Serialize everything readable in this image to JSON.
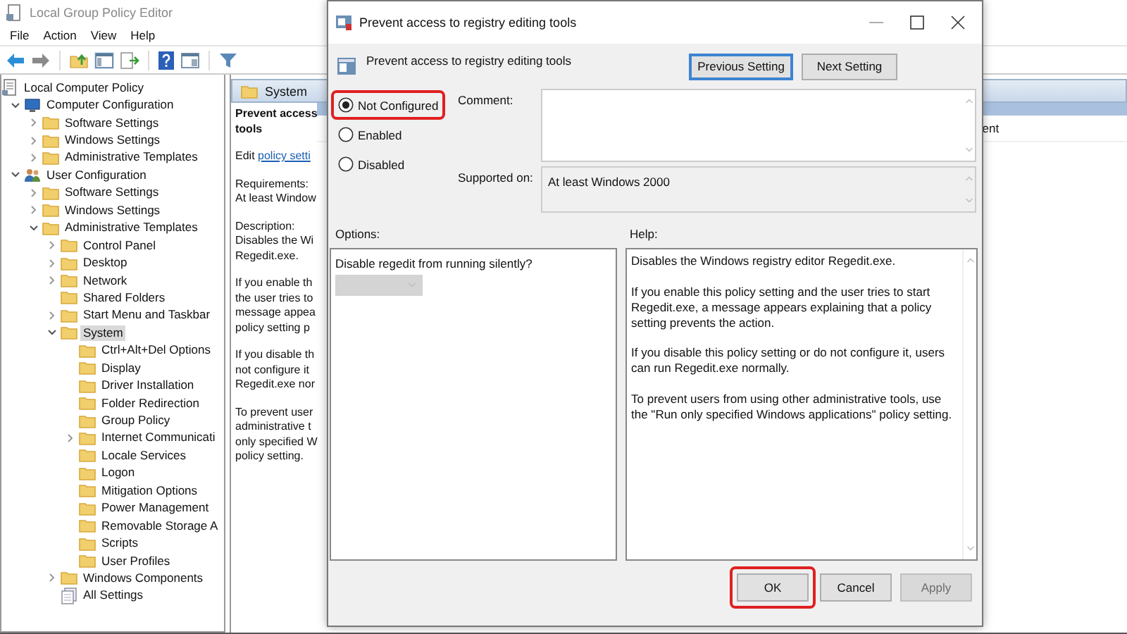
{
  "main_window": {
    "title": "Local Group Policy Editor",
    "menu": [
      "File",
      "Action",
      "View",
      "Help"
    ]
  },
  "tree": [
    {
      "label": "Local Computer Policy",
      "kind": "policy",
      "selected": false,
      "children": [
        {
          "label": "Computer Configuration",
          "kind": "computer",
          "expanded": true,
          "selected": false,
          "children": [
            {
              "label": "Software Settings",
              "kind": "folder",
              "expanded": false,
              "selected": false
            },
            {
              "label": "Windows Settings",
              "kind": "folder",
              "expanded": false,
              "selected": false
            },
            {
              "label": "Administrative Templates",
              "kind": "folder",
              "expanded": false,
              "selected": false
            }
          ]
        },
        {
          "label": "User Configuration",
          "kind": "user",
          "expanded": true,
          "selected": false,
          "children": [
            {
              "label": "Software Settings",
              "kind": "folder",
              "expanded": false,
              "selected": false
            },
            {
              "label": "Windows Settings",
              "kind": "folder",
              "expanded": false,
              "selected": false
            },
            {
              "label": "Administrative Templates",
              "kind": "folder",
              "expanded": true,
              "selected": false,
              "children": [
                {
                  "label": "Control Panel",
                  "kind": "folder",
                  "expanded": false,
                  "selected": false
                },
                {
                  "label": "Desktop",
                  "kind": "folder",
                  "expanded": false,
                  "selected": false
                },
                {
                  "label": "Network",
                  "kind": "folder",
                  "expanded": false,
                  "selected": false
                },
                {
                  "label": "Shared Folders",
                  "kind": "folder",
                  "selected": false
                },
                {
                  "label": "Start Menu and Taskbar",
                  "kind": "folder",
                  "expanded": false,
                  "selected": false
                },
                {
                  "label": "System",
                  "kind": "folder",
                  "expanded": true,
                  "selected": true,
                  "children": [
                    {
                      "label": "Ctrl+Alt+Del Options",
                      "kind": "folder",
                      "selected": false
                    },
                    {
                      "label": "Display",
                      "kind": "folder",
                      "selected": false
                    },
                    {
                      "label": "Driver Installation",
                      "kind": "folder",
                      "selected": false
                    },
                    {
                      "label": "Folder Redirection",
                      "kind": "folder",
                      "selected": false
                    },
                    {
                      "label": "Group Policy",
                      "kind": "folder",
                      "selected": false
                    },
                    {
                      "label": "Internet Communicati",
                      "kind": "folder",
                      "expanded": false,
                      "selected": false
                    },
                    {
                      "label": "Locale Services",
                      "kind": "folder",
                      "selected": false
                    },
                    {
                      "label": "Logon",
                      "kind": "folder",
                      "selected": false
                    },
                    {
                      "label": "Mitigation Options",
                      "kind": "folder",
                      "selected": false
                    },
                    {
                      "label": "Power Management",
                      "kind": "folder",
                      "selected": false
                    },
                    {
                      "label": "Removable Storage A",
                      "kind": "folder",
                      "selected": false
                    },
                    {
                      "label": "Scripts",
                      "kind": "folder",
                      "selected": false
                    },
                    {
                      "label": "User Profiles",
                      "kind": "folder",
                      "selected": false
                    }
                  ]
                },
                {
                  "label": "Windows Components",
                  "kind": "folder",
                  "expanded": false,
                  "selected": false
                },
                {
                  "label": "All Settings",
                  "kind": "settings",
                  "selected": false
                }
              ]
            }
          ]
        }
      ]
    }
  ],
  "detail_pane": {
    "header": "System",
    "title_lines": [
      "Prevent access",
      "tools"
    ],
    "edit_prefix": "Edit",
    "edit_link": "policy setti",
    "paragraphs": [
      [
        "Requirements:",
        "At least Window"
      ],
      [
        "Description:",
        "Disables the Wi",
        "Regedit.exe."
      ],
      [
        "If you enable th",
        "the user tries to",
        "message appea",
        "policy setting p"
      ],
      [
        "If you disable th",
        "not configure it",
        "Regedit.exe nor"
      ],
      [
        "To prevent user",
        "administrative t",
        "only specified W",
        "policy setting."
      ]
    ]
  },
  "settings_list": {
    "cell": "ent"
  },
  "dialog": {
    "title": "Prevent access to registry editing tools",
    "setting_name": "Prevent access to registry editing tools",
    "nav_buttons": [
      {
        "label": "Previous Setting",
        "focused": true
      },
      {
        "label": "Next Setting",
        "focused": false
      }
    ],
    "states": [
      {
        "label": "Not Configured",
        "selected": true,
        "highlighted": true
      },
      {
        "label": "Enabled",
        "selected": false,
        "highlighted": false
      },
      {
        "label": "Disabled",
        "selected": false,
        "highlighted": false
      }
    ],
    "comment_label": "Comment:",
    "supported_label": "Supported on:",
    "supported_value": "At least Windows 2000",
    "options_label": "Options:",
    "help_label": "Help:",
    "option_prompt": "Disable regedit from running silently?",
    "option_dropdown": {
      "disabled": true
    },
    "help_paragraphs": [
      "Disables the Windows registry editor Regedit.exe.",
      "If you enable this policy setting and the user tries to start Regedit.exe, a message appears explaining that a policy setting prevents the action.",
      "If you disable this policy setting or do not configure it, users can run Regedit.exe normally.",
      "To prevent users from using other administrative tools, use the \"Run only specified Windows applications\" policy setting."
    ],
    "buttons": [
      {
        "label": "OK",
        "disabled": false,
        "highlighted": true
      },
      {
        "label": "Cancel",
        "disabled": false,
        "highlighted": false
      },
      {
        "label": "Apply",
        "disabled": true,
        "highlighted": false
      }
    ]
  }
}
